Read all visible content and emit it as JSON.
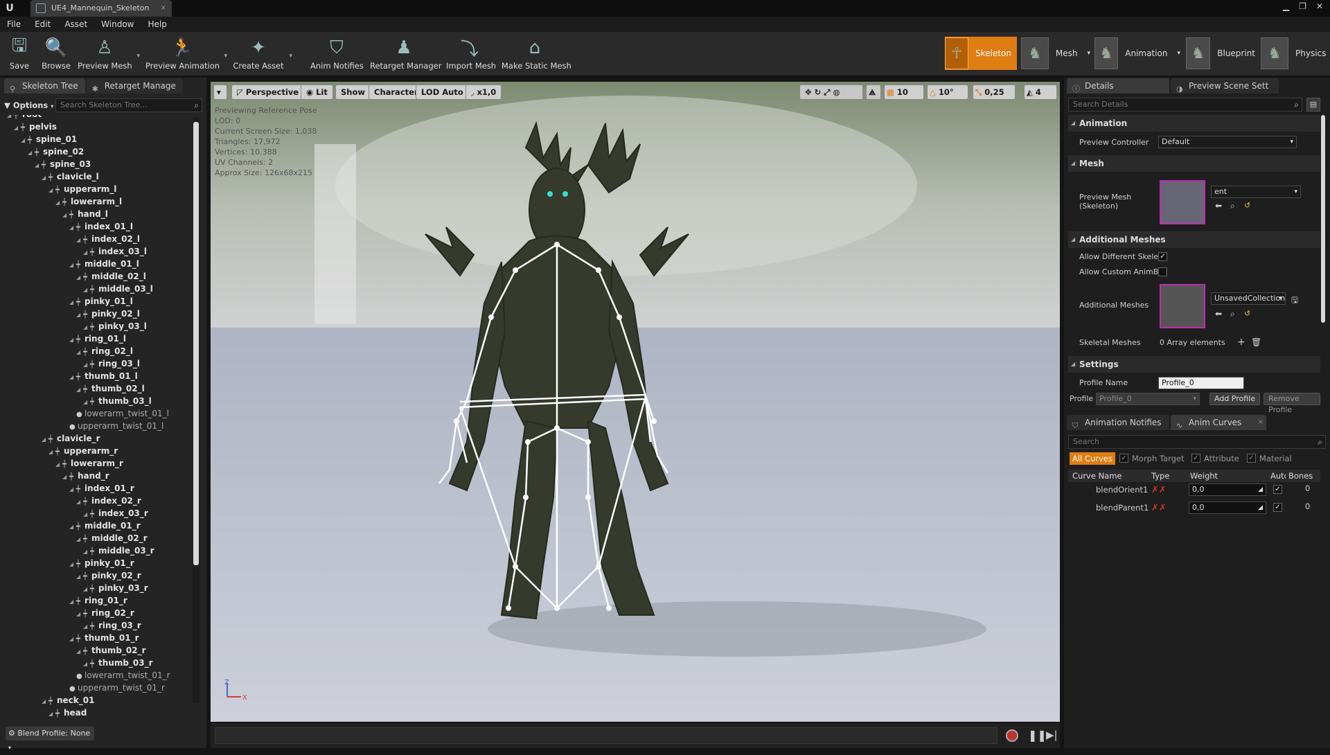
{
  "window": {
    "tab_title": "UE4_Mannequin_Skeleton",
    "tab_close": "×",
    "controls": [
      "▁",
      "❐",
      "✕"
    ]
  },
  "menu": [
    "File",
    "Edit",
    "Asset",
    "Window",
    "Help"
  ],
  "toolbar": [
    {
      "label": "Save",
      "icon": "save-icon"
    },
    {
      "label": "Browse",
      "icon": "browse-icon"
    },
    {
      "label": "Preview Mesh",
      "icon": "preview-mesh-icon"
    },
    {
      "label": "Preview Animation",
      "icon": "preview-animation-icon"
    },
    {
      "label": "Create Asset",
      "icon": "create-asset-icon"
    },
    {
      "label": "Anim Notifies",
      "icon": "anim-notifies-icon"
    },
    {
      "label": "Retarget Manager",
      "icon": "retarget-manager-icon"
    },
    {
      "label": "Import Mesh",
      "icon": "import-mesh-icon"
    },
    {
      "label": "Make Static Mesh",
      "icon": "make-static-mesh-icon"
    }
  ],
  "modes": [
    "Skeleton",
    "Mesh",
    "Animation",
    "Blueprint",
    "Physics"
  ],
  "left": {
    "tabs": [
      "Skeleton Tree",
      "Retarget Manage"
    ],
    "options": "Options",
    "search_placeholder": "Search Skeleton Tree...",
    "blend_profile": "Blend Profile: None",
    "bones": [
      {
        "n": "root",
        "d": 0
      },
      {
        "n": "pelvis",
        "d": 1
      },
      {
        "n": "spine_01",
        "d": 2
      },
      {
        "n": "spine_02",
        "d": 3
      },
      {
        "n": "spine_03",
        "d": 4
      },
      {
        "n": "clavicle_l",
        "d": 5
      },
      {
        "n": "upperarm_l",
        "d": 6
      },
      {
        "n": "lowerarm_l",
        "d": 7
      },
      {
        "n": "hand_l",
        "d": 8
      },
      {
        "n": "index_01_l",
        "d": 9
      },
      {
        "n": "index_02_l",
        "d": 10
      },
      {
        "n": "index_03_l",
        "d": 11
      },
      {
        "n": "middle_01_l",
        "d": 9
      },
      {
        "n": "middle_02_l",
        "d": 10
      },
      {
        "n": "middle_03_l",
        "d": 11
      },
      {
        "n": "pinky_01_l",
        "d": 9
      },
      {
        "n": "pinky_02_l",
        "d": 10
      },
      {
        "n": "pinky_03_l",
        "d": 11
      },
      {
        "n": "ring_01_l",
        "d": 9
      },
      {
        "n": "ring_02_l",
        "d": 10
      },
      {
        "n": "ring_03_l",
        "d": 11
      },
      {
        "n": "thumb_01_l",
        "d": 9
      },
      {
        "n": "thumb_02_l",
        "d": 10
      },
      {
        "n": "thumb_03_l",
        "d": 11
      },
      {
        "n": "lowerarm_twist_01_l",
        "d": 9,
        "soft": true
      },
      {
        "n": "upperarm_twist_01_l",
        "d": 8,
        "soft": true
      },
      {
        "n": "clavicle_r",
        "d": 5
      },
      {
        "n": "upperarm_r",
        "d": 6
      },
      {
        "n": "lowerarm_r",
        "d": 7
      },
      {
        "n": "hand_r",
        "d": 8
      },
      {
        "n": "index_01_r",
        "d": 9
      },
      {
        "n": "index_02_r",
        "d": 10
      },
      {
        "n": "index_03_r",
        "d": 11
      },
      {
        "n": "middle_01_r",
        "d": 9
      },
      {
        "n": "middle_02_r",
        "d": 10
      },
      {
        "n": "middle_03_r",
        "d": 11
      },
      {
        "n": "pinky_01_r",
        "d": 9
      },
      {
        "n": "pinky_02_r",
        "d": 10
      },
      {
        "n": "pinky_03_r",
        "d": 11
      },
      {
        "n": "ring_01_r",
        "d": 9
      },
      {
        "n": "ring_02_r",
        "d": 10
      },
      {
        "n": "ring_03_r",
        "d": 11
      },
      {
        "n": "thumb_01_r",
        "d": 9
      },
      {
        "n": "thumb_02_r",
        "d": 10
      },
      {
        "n": "thumb_03_r",
        "d": 11
      },
      {
        "n": "lowerarm_twist_01_r",
        "d": 9,
        "soft": true
      },
      {
        "n": "upperarm_twist_01_r",
        "d": 8,
        "soft": true
      },
      {
        "n": "neck_01",
        "d": 5
      },
      {
        "n": "head",
        "d": 6
      }
    ]
  },
  "viewport": {
    "buttons": [
      "▾",
      "Perspective",
      "Lit",
      "Show",
      "Character",
      "LOD Auto",
      "x1,0"
    ],
    "right_controls": [
      "10",
      "10°",
      "0,25",
      "4"
    ],
    "stats": [
      "Previewing Reference Pose",
      "LOD: 0",
      "Current Screen Size: 1,038",
      "Triangles: 17,972",
      "Vertices: 10,388",
      "UV Channels: 2",
      "Approx Size: 126x68x215"
    ],
    "axis": {
      "z": "Z",
      "x": "X"
    }
  },
  "details": {
    "tabs": [
      "Details",
      "Preview Scene Sett"
    ],
    "search_placeholder": "Search Details",
    "sections": {
      "animation": "Animation",
      "mesh": "Mesh",
      "additional": "Additional Meshes",
      "settings": "Settings"
    },
    "preview_controller_label": "Preview Controller",
    "preview_controller_value": "Default",
    "preview_mesh_label": "Preview Mesh\n(Skeleton)",
    "preview_mesh_value": "ent",
    "allow_diff_label": "Allow Different Skelet",
    "allow_custom_label": "Allow Custom AnimBl",
    "additional_meshes_label": "Additional Meshes",
    "additional_meshes_value": "UnsavedCollection",
    "skeletal_meshes_label": "Skeletal Meshes",
    "skeletal_meshes_value": "0 Array elements",
    "profile_name_label": "Profile Name",
    "profile_name_value": "Profile_0",
    "profile_label": "Profile",
    "profile_value": "Profile_0",
    "add_profile": "Add Profile",
    "remove_profile": "Remove Profile"
  },
  "curves": {
    "tabs": [
      "Animation Notifies",
      "Anim Curves"
    ],
    "search_placeholder": "Search",
    "filters": [
      "All Curves",
      "Morph Target",
      "Attribute",
      "Material"
    ],
    "columns": [
      "Curve Name",
      "Type",
      "Weight",
      "Auto",
      "Bones"
    ],
    "rows": [
      {
        "name": "blendOrient1",
        "weight": "0,0",
        "bones": "0"
      },
      {
        "name": "blendParent1",
        "weight": "0,0",
        "bones": "0"
      }
    ]
  },
  "colors": {
    "accent": "#e07d12",
    "bone": "#ffffff",
    "selection": "#c02ab4"
  }
}
